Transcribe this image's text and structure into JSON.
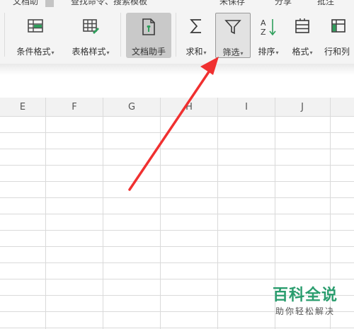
{
  "topbar": {
    "items": [
      "文档助",
      "查找命令、搜索模板",
      "未保存",
      "分享",
      "批注"
    ]
  },
  "ribbon": {
    "buttons": [
      {
        "label": "条件格式",
        "icon": "conditional-format-icon",
        "dropdown": true
      },
      {
        "label": "表格样式",
        "icon": "table-style-icon",
        "dropdown": true
      },
      {
        "label": "文档助手",
        "icon": "document-assistant-icon",
        "dropdown": false,
        "state": "active"
      },
      {
        "label": "求和",
        "icon": "sum-icon",
        "dropdown": true
      },
      {
        "label": "筛选",
        "icon": "filter-icon",
        "dropdown": true,
        "state": "highlighted"
      },
      {
        "label": "排序",
        "icon": "sort-icon",
        "dropdown": true
      },
      {
        "label": "格式",
        "icon": "format-icon",
        "dropdown": true
      },
      {
        "label": "行和列",
        "icon": "rows-columns-icon",
        "dropdown": false
      }
    ],
    "dropdown_glyph": "▾"
  },
  "sheet": {
    "columns": [
      "E",
      "F",
      "G",
      "H",
      "I",
      "J"
    ]
  },
  "annotation": {
    "color": "#f03030"
  },
  "watermark": {
    "title": "百科全说",
    "subtitle": "助你轻松解决",
    "color": "#2a9d6e"
  }
}
